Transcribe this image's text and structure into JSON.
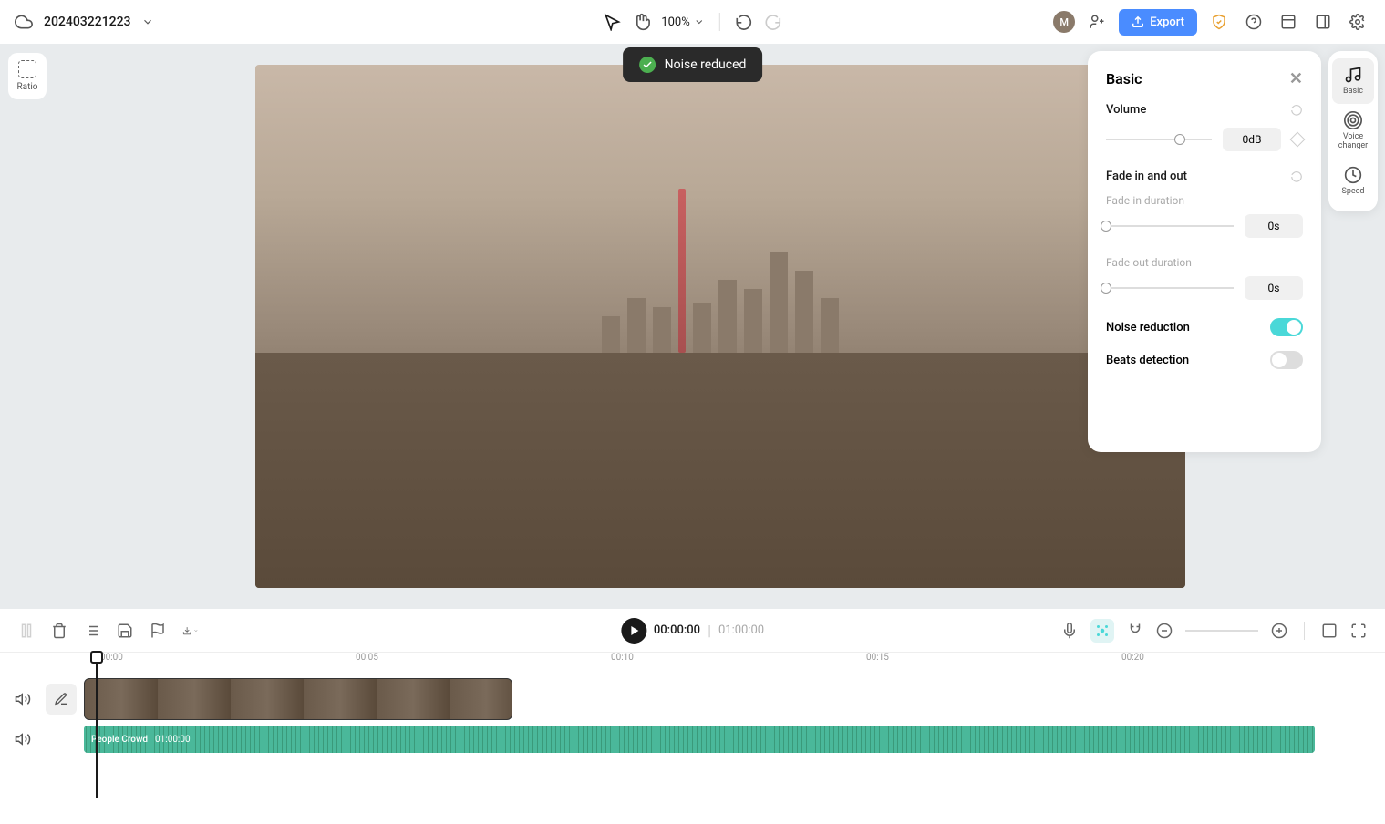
{
  "header": {
    "project_name": "202403221223",
    "zoom": "100%",
    "avatar_letter": "M",
    "export_label": "Export"
  },
  "toast": {
    "message": "Noise reduced"
  },
  "left_tools": {
    "ratio_label": "Ratio"
  },
  "panel": {
    "title": "Basic",
    "volume": {
      "label": "Volume",
      "value": "0dB"
    },
    "fade": {
      "label": "Fade in and out",
      "in_label": "Fade-in duration",
      "in_value": "0s",
      "out_label": "Fade-out duration",
      "out_value": "0s"
    },
    "noise_reduction": {
      "label": "Noise reduction",
      "enabled": true
    },
    "beats_detection": {
      "label": "Beats detection",
      "enabled": false
    }
  },
  "side_tabs": {
    "basic": "Basic",
    "voice_changer": "Voice changer",
    "speed": "Speed"
  },
  "timeline": {
    "current_time": "00:00:00",
    "total_time": "01:00:00",
    "ruler_marks": [
      "00:00",
      "00:05",
      "00:10",
      "00:15",
      "00:20"
    ],
    "audio_clip_name": "People Crowd",
    "audio_clip_duration": "01:00:00"
  }
}
